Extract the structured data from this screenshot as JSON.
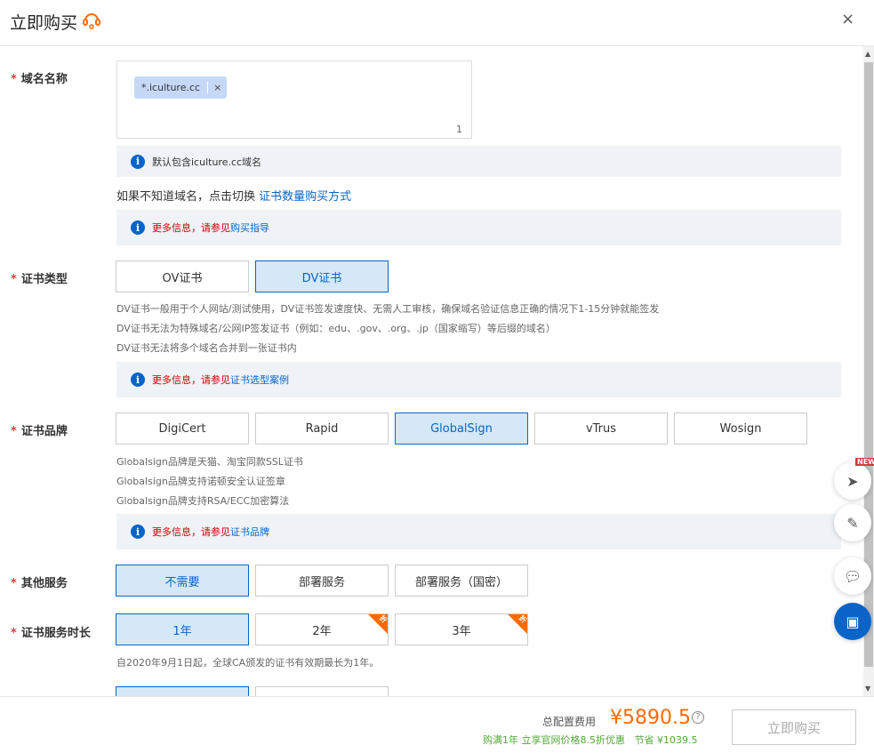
{
  "header": {
    "title": "立即购买",
    "close": "×"
  },
  "domain": {
    "label": "域名名称",
    "tag": "*.iculture.cc",
    "tag_remove": "×",
    "count": "1",
    "note": "默认包含iculture.cc域名",
    "switch_text": "如果不知道域名，点击切换",
    "switch_link": "证书数量购买方式",
    "more_red": "更多信息，请参见",
    "more_link": "购买指导"
  },
  "cert_type": {
    "label": "证书类型",
    "options": [
      "OV证书",
      "DV证书"
    ],
    "selected": "DV证书",
    "desc": [
      "DV证书一般用于个人网站/测试使用，DV证书签发速度快、无需人工审核，确保域名验证信息正确的情况下1-15分钟就能签发",
      "DV证书无法为特殊域名/公网IP签发证书（例如：edu、.gov、.org、.jp（国家缩写）等后缀的域名）",
      "DV证书无法将多个域名合并到一张证书内"
    ],
    "more_red": "更多信息，请参见",
    "more_link": "证书选型案例"
  },
  "brand": {
    "label": "证书品牌",
    "options": [
      "DigiCert",
      "Rapid",
      "GlobalSign",
      "vTrus",
      "Wosign"
    ],
    "selected": "GlobalSign",
    "desc": [
      "Globalsign品牌是天猫、淘宝同款SSL证书",
      "Globalsign品牌支持诺顿安全认证签章",
      "Globalsign品牌支持RSA/ECC加密算法"
    ],
    "more_red": "更多信息，请参见",
    "more_link": "证书品牌"
  },
  "services": {
    "label": "其他服务",
    "options": [
      "不需要",
      "部署服务",
      "部署服务（国密）"
    ],
    "selected": "不需要"
  },
  "duration": {
    "label": "证书服务时长",
    "options": [
      "1年",
      "2年",
      "3年"
    ],
    "selected": "1年",
    "discount_badge": "折",
    "note": "自2020年9月1日起，全球CA颁发的证书有效期最长为1年。"
  },
  "side": {
    "new_badge": "NEW"
  },
  "footer": {
    "total_label": "总配置费用",
    "price": "¥5890.5",
    "help": "?",
    "promo": "购满1年 立享官网价格8.5折优惠",
    "save_label": "节省",
    "save": "¥1039.5",
    "buy": "立即购买"
  },
  "colors": {
    "accent": "#0a64c8",
    "price": "#ff6a00",
    "promo": "#52a838"
  }
}
